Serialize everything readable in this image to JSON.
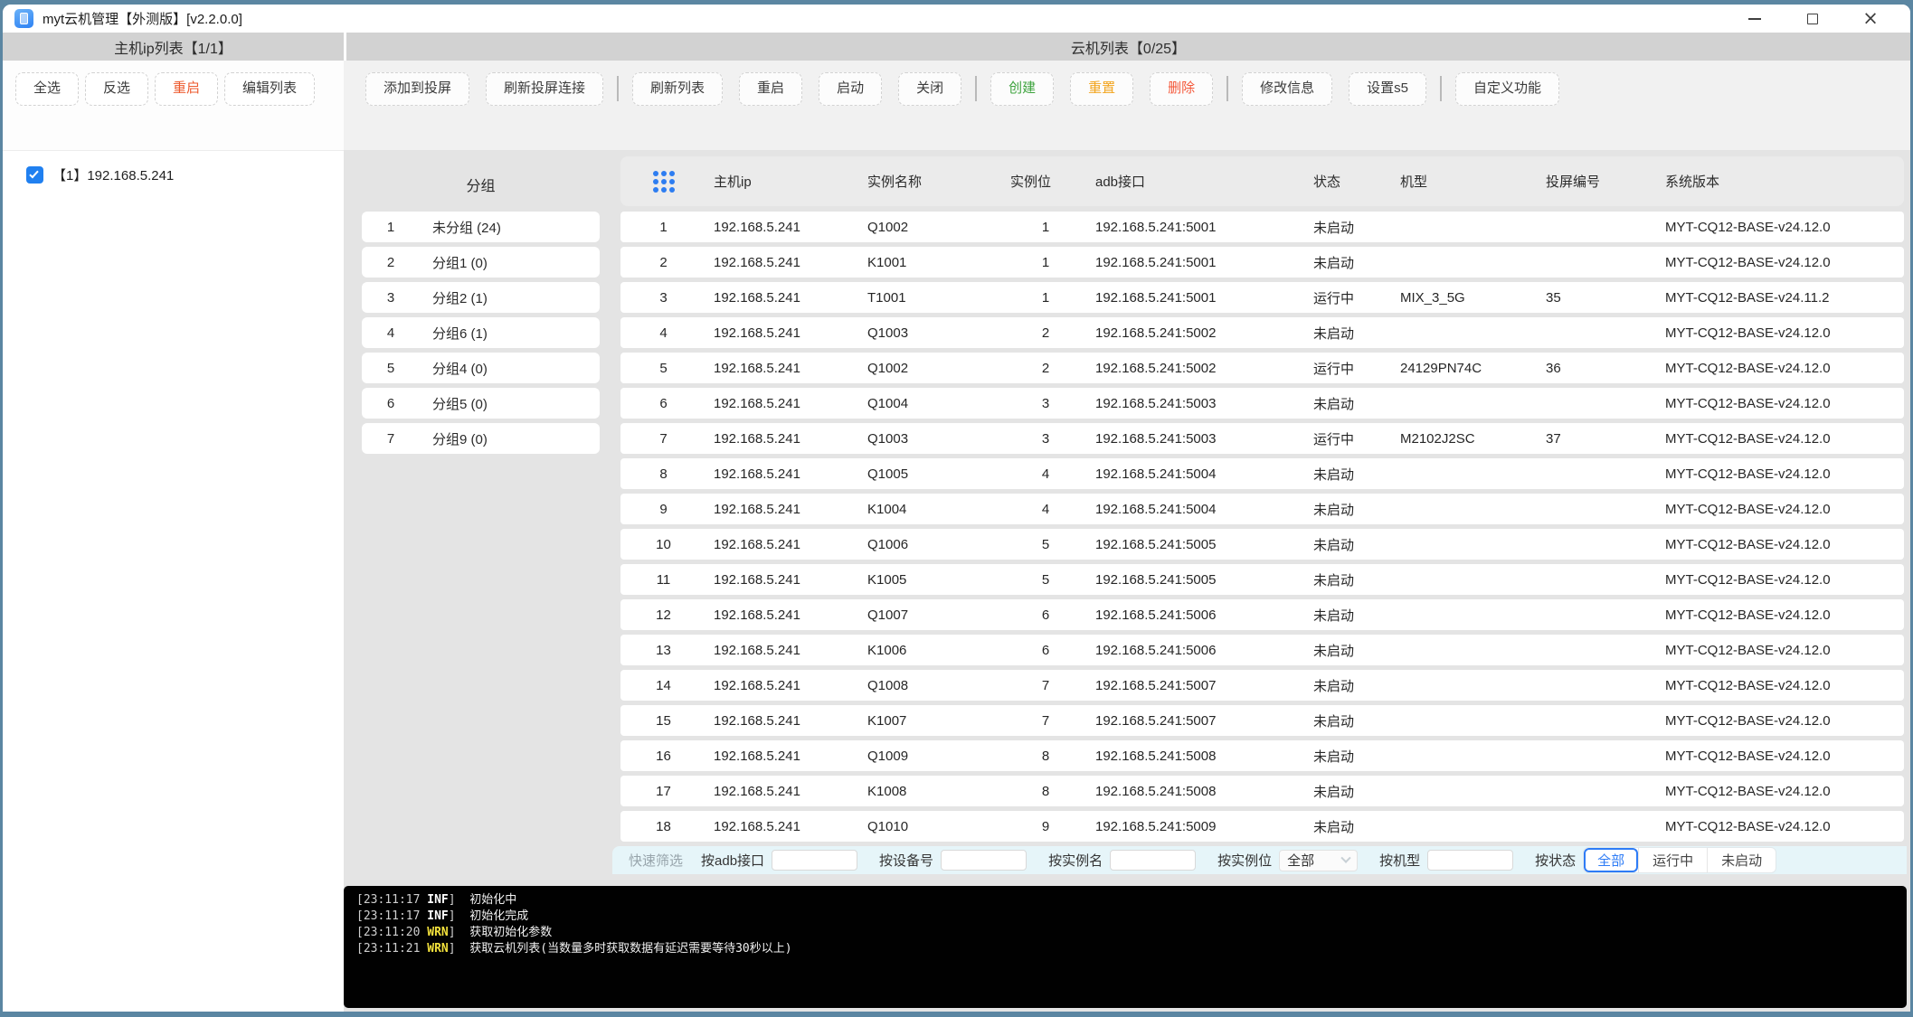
{
  "window": {
    "title": "myt云机管理【外测版】[v2.2.0.0]",
    "controls": {
      "minimize": "minimize",
      "maximize": "maximize",
      "close": "close"
    }
  },
  "left_panel": {
    "header": "主机ip列表【1/1】",
    "buttons": [
      {
        "label": "全选",
        "accent": null
      },
      {
        "label": "反选",
        "accent": null
      },
      {
        "label": "重启",
        "accent": "#ed5a2e"
      },
      {
        "label": "编辑列表",
        "accent": null
      }
    ],
    "hosts": [
      {
        "checked": true,
        "label": "【1】192.168.5.241"
      }
    ]
  },
  "cloud_panel": {
    "header": "云机列表【0/25】"
  },
  "toolbar": {
    "groups": [
      [
        {
          "label": "添加到投屏",
          "accent": null
        },
        {
          "label": "刷新投屏连接",
          "accent": null
        }
      ],
      [
        {
          "label": "刷新列表",
          "accent": null
        },
        {
          "label": "重启",
          "accent": null
        },
        {
          "label": "启动",
          "accent": null
        },
        {
          "label": "关闭",
          "accent": null
        }
      ],
      [
        {
          "label": "创建",
          "accent": "#3da33d"
        },
        {
          "label": "重置",
          "accent": "#f2a51f"
        },
        {
          "label": "删除",
          "accent": "#f4583a"
        }
      ],
      [
        {
          "label": "修改信息",
          "accent": null
        },
        {
          "label": "设置s5",
          "accent": null
        }
      ],
      [
        {
          "label": "自定义功能",
          "accent": null
        }
      ]
    ]
  },
  "groups": {
    "header": "分组",
    "rows": [
      {
        "num": "1",
        "label": "未分组 (24)"
      },
      {
        "num": "2",
        "label": "分组1 (0)"
      },
      {
        "num": "3",
        "label": "分组2 (1)"
      },
      {
        "num": "4",
        "label": "分组6 (1)"
      },
      {
        "num": "5",
        "label": "分组4 (0)"
      },
      {
        "num": "6",
        "label": "分组5 (0)"
      },
      {
        "num": "7",
        "label": "分组9 (0)"
      }
    ]
  },
  "table": {
    "columns": [
      "主机ip",
      "实例名称",
      "实例位",
      "adb接口",
      "状态",
      "机型",
      "投屏编号",
      "系统版本"
    ],
    "rows": [
      [
        "1",
        "192.168.5.241",
        "Q1002",
        "1",
        "192.168.5.241:5001",
        "未启动",
        "",
        "",
        "MYT-CQ12-BASE-v24.12.0"
      ],
      [
        "2",
        "192.168.5.241",
        "K1001",
        "1",
        "192.168.5.241:5001",
        "未启动",
        "",
        "",
        "MYT-CQ12-BASE-v24.12.0"
      ],
      [
        "3",
        "192.168.5.241",
        "T1001",
        "1",
        "192.168.5.241:5001",
        "运行中",
        "MIX_3_5G",
        "35",
        "MYT-CQ12-BASE-v24.11.2"
      ],
      [
        "4",
        "192.168.5.241",
        "Q1003",
        "2",
        "192.168.5.241:5002",
        "未启动",
        "",
        "",
        "MYT-CQ12-BASE-v24.12.0"
      ],
      [
        "5",
        "192.168.5.241",
        "Q1002",
        "2",
        "192.168.5.241:5002",
        "运行中",
        "24129PN74C",
        "36",
        "MYT-CQ12-BASE-v24.12.0"
      ],
      [
        "6",
        "192.168.5.241",
        "Q1004",
        "3",
        "192.168.5.241:5003",
        "未启动",
        "",
        "",
        "MYT-CQ12-BASE-v24.12.0"
      ],
      [
        "7",
        "192.168.5.241",
        "Q1003",
        "3",
        "192.168.5.241:5003",
        "运行中",
        "M2102J2SC",
        "37",
        "MYT-CQ12-BASE-v24.12.0"
      ],
      [
        "8",
        "192.168.5.241",
        "Q1005",
        "4",
        "192.168.5.241:5004",
        "未启动",
        "",
        "",
        "MYT-CQ12-BASE-v24.12.0"
      ],
      [
        "9",
        "192.168.5.241",
        "K1004",
        "4",
        "192.168.5.241:5004",
        "未启动",
        "",
        "",
        "MYT-CQ12-BASE-v24.12.0"
      ],
      [
        "10",
        "192.168.5.241",
        "Q1006",
        "5",
        "192.168.5.241:5005",
        "未启动",
        "",
        "",
        "MYT-CQ12-BASE-v24.12.0"
      ],
      [
        "11",
        "192.168.5.241",
        "K1005",
        "5",
        "192.168.5.241:5005",
        "未启动",
        "",
        "",
        "MYT-CQ12-BASE-v24.12.0"
      ],
      [
        "12",
        "192.168.5.241",
        "Q1007",
        "6",
        "192.168.5.241:5006",
        "未启动",
        "",
        "",
        "MYT-CQ12-BASE-v24.12.0"
      ],
      [
        "13",
        "192.168.5.241",
        "K1006",
        "6",
        "192.168.5.241:5006",
        "未启动",
        "",
        "",
        "MYT-CQ12-BASE-v24.12.0"
      ],
      [
        "14",
        "192.168.5.241",
        "Q1008",
        "7",
        "192.168.5.241:5007",
        "未启动",
        "",
        "",
        "MYT-CQ12-BASE-v24.12.0"
      ],
      [
        "15",
        "192.168.5.241",
        "K1007",
        "7",
        "192.168.5.241:5007",
        "未启动",
        "",
        "",
        "MYT-CQ12-BASE-v24.12.0"
      ],
      [
        "16",
        "192.168.5.241",
        "Q1009",
        "8",
        "192.168.5.241:5008",
        "未启动",
        "",
        "",
        "MYT-CQ12-BASE-v24.12.0"
      ],
      [
        "17",
        "192.168.5.241",
        "K1008",
        "8",
        "192.168.5.241:5008",
        "未启动",
        "",
        "",
        "MYT-CQ12-BASE-v24.12.0"
      ],
      [
        "18",
        "192.168.5.241",
        "Q1010",
        "9",
        "192.168.5.241:5009",
        "未启动",
        "",
        "",
        "MYT-CQ12-BASE-v24.12.0"
      ]
    ]
  },
  "filter": {
    "title": "快速筛选",
    "adb_label": "按adb接口",
    "device_label": "按设备号",
    "name_label": "按实例名",
    "pos_label": "按实例位",
    "pos_value": "全部",
    "model_label": "按机型",
    "status_label": "按状态",
    "status_options": [
      "全部",
      "运行中",
      "未启动"
    ],
    "status_selected": "全部"
  },
  "console": {
    "lines": [
      {
        "time": "23:11:17",
        "level": "INF",
        "message": "初始化中"
      },
      {
        "time": "23:11:17",
        "level": "INF",
        "message": "初始化完成"
      },
      {
        "time": "23:11:20",
        "level": "WRN",
        "message": "获取初始化参数"
      },
      {
        "time": "23:11:21",
        "level": "WRN",
        "message": "获取云机列表(当数量多时获取数据有延迟需要等待30秒以上)"
      }
    ]
  },
  "colors": {
    "accent_blue": "#2080f0",
    "grid_icon_blue": "#2d7df1",
    "restart_orange": "#ed5a2e",
    "create_green": "#3da33d",
    "reset_amber": "#f2a51f",
    "delete_red": "#f4583a",
    "warn_yellow": "#f3e13c",
    "filter_bg": "#e6f5f9",
    "header_band": "#d2d2d2"
  }
}
